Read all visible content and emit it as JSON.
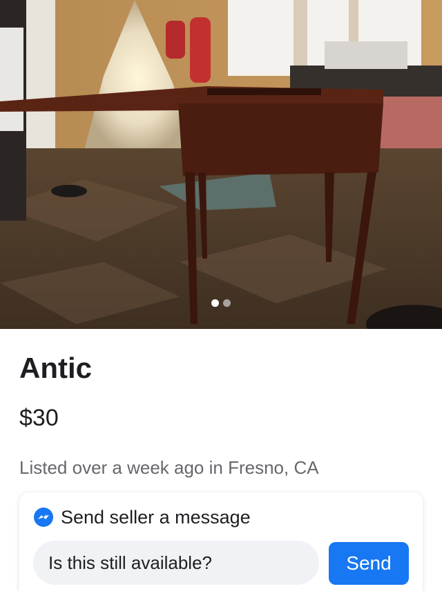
{
  "listing": {
    "title": "Antic",
    "price": "$30",
    "meta": "Listed over a week ago in Fresno, CA"
  },
  "photo": {
    "current_index": 1,
    "total": 2,
    "subject": "wooden sewing table"
  },
  "message": {
    "heading": "Send seller a message",
    "icon": "messenger-icon",
    "input_value": "Is this still available?",
    "send_label": "Send"
  },
  "colors": {
    "accent": "#1877f2",
    "text_primary": "#1c1e21",
    "text_secondary": "#65676b",
    "input_bg": "#f0f2f5"
  }
}
